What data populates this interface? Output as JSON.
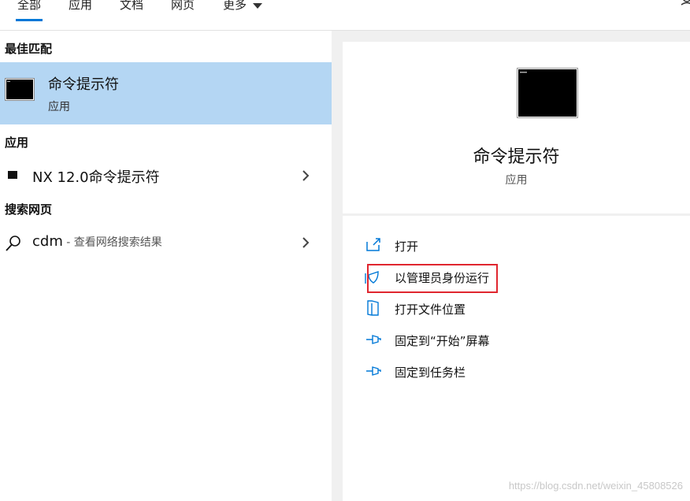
{
  "tabs": [
    {
      "label": "全部",
      "active": true
    },
    {
      "label": "应用"
    },
    {
      "label": "文档"
    },
    {
      "label": "网页"
    },
    {
      "label": "更多"
    }
  ],
  "sections": {
    "best_match": "最佳匹配",
    "apps": "应用",
    "web": "搜索网页"
  },
  "best_match": {
    "title": "命令提示符",
    "subtitle": "应用"
  },
  "apps": [
    {
      "label": "NX 12.0命令提示符"
    }
  ],
  "web": [
    {
      "query": "cdm",
      "suffix": " - 查看网络搜索结果"
    }
  ],
  "detail": {
    "title": "命令提示符",
    "subtitle": "应用",
    "actions": [
      {
        "label": "打开",
        "icon": "open-icon"
      },
      {
        "label": "以管理员身份运行",
        "icon": "shield-icon"
      },
      {
        "label": "打开文件位置",
        "icon": "folder-location-icon"
      },
      {
        "label": "固定到“开始”屏幕",
        "icon": "pin-icon"
      },
      {
        "label": "固定到任务栏",
        "icon": "pin-icon"
      }
    ]
  },
  "watermark": "https://blog.csdn.net/weixin_45808526",
  "colors": {
    "accent": "#0078d7",
    "selected": "#b4d6f3",
    "highlight": "#e0262f"
  }
}
